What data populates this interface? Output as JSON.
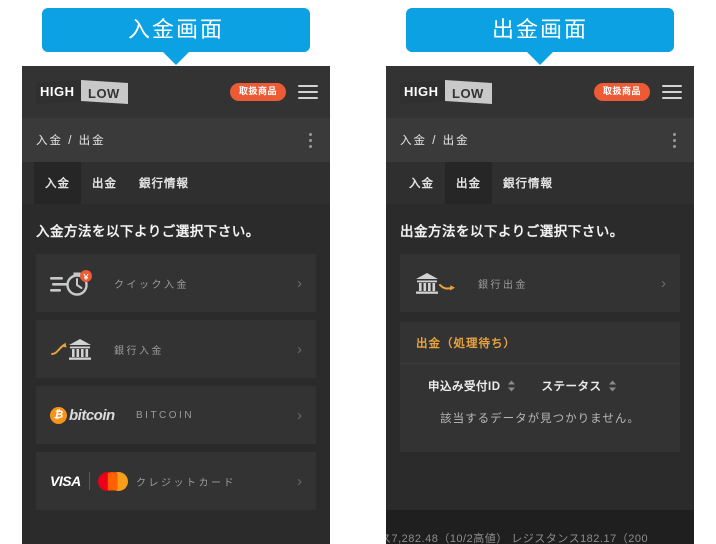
{
  "panels": [
    {
      "callout": "入金画面",
      "header": {
        "logo_high": "HIGH",
        "logo_low": "LOW",
        "pill_label": "取扱商品",
        "menu_icon": "hamburger-menu-icon"
      },
      "breadcrumb": "入金 / 出金",
      "tabs": [
        {
          "label": "入金",
          "active": true
        },
        {
          "label": "出金",
          "active": false
        },
        {
          "label": "銀行情報",
          "active": false
        }
      ],
      "section_title": "入金方法を以下よりご選択下さい。",
      "methods": [
        {
          "label": "クイック入金",
          "icon": "stopwatch-speed-icon",
          "chevron": "›"
        },
        {
          "label": "銀行入金",
          "icon": "bank-arrow-in-icon",
          "chevron": "›"
        },
        {
          "label": "BITCOIN",
          "icon": "bitcoin-logo-icon",
          "bitcoin_symbol": "₿",
          "bitcoin_word": "bitcoin",
          "chevron": "›"
        },
        {
          "label": "クレジットカード",
          "icon": "visa-mastercard-icon",
          "visa_word": "VISA",
          "chevron": "›"
        }
      ]
    },
    {
      "callout": "出金画面",
      "header": {
        "logo_high": "HIGH",
        "logo_low": "LOW",
        "pill_label": "取扱商品",
        "menu_icon": "hamburger-menu-icon"
      },
      "breadcrumb": "入金 / 出金",
      "tabs": [
        {
          "label": "入金",
          "active": false
        },
        {
          "label": "出金",
          "active": true
        },
        {
          "label": "銀行情報",
          "active": false
        }
      ],
      "section_title": "出金方法を以下よりご選択下さい。",
      "methods": [
        {
          "label": "銀行出金",
          "icon": "bank-arrow-out-icon",
          "chevron": "›"
        }
      ],
      "pending": {
        "title": "出金（処理待ち）",
        "columns": [
          "申込み受付ID",
          "ステータス"
        ],
        "empty_message": "該当するデータが見つかりません。"
      },
      "ticker": "ス7,282.48（10/2高値）  レジスタンス182.17（200"
    }
  ],
  "colors": {
    "callout_blue": "#0ba1e2",
    "pill_orange": "#ec5b33",
    "pending_title_orange": "#e8a33d",
    "bitcoin_orange": "#f7931a",
    "app_bg": "#2b2b2b",
    "header_bg": "#333333"
  }
}
